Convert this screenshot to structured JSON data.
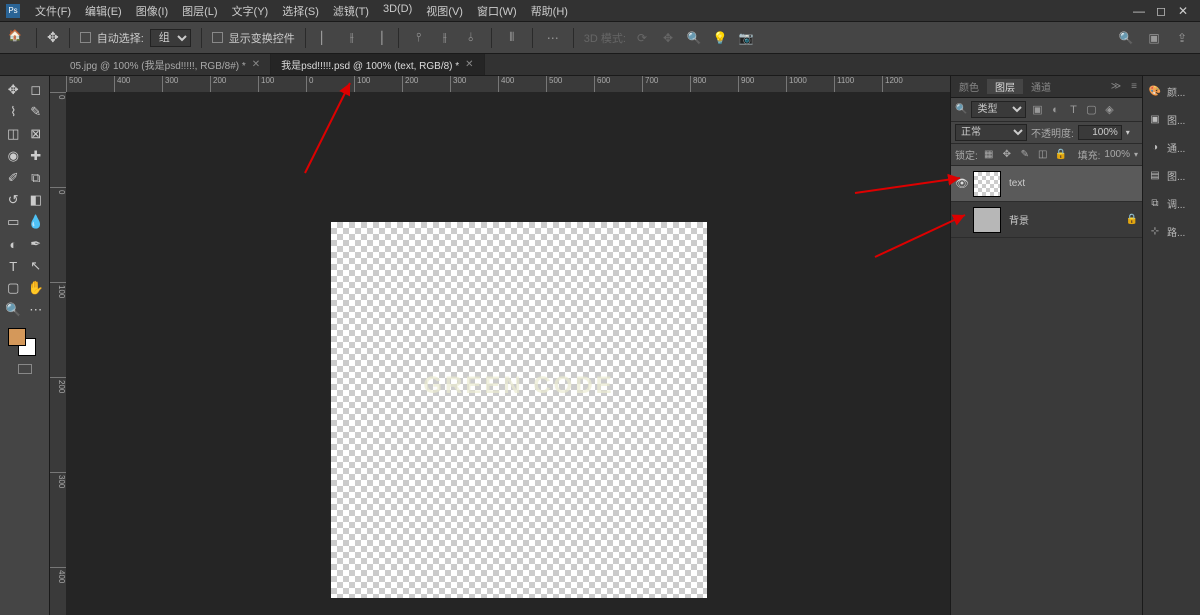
{
  "menubar": {
    "items": [
      "文件(F)",
      "编辑(E)",
      "图像(I)",
      "图层(L)",
      "文字(Y)",
      "选择(S)",
      "滤镜(T)",
      "3D(D)",
      "视图(V)",
      "窗口(W)",
      "帮助(H)"
    ]
  },
  "optionsbar": {
    "auto_select_label": "自动选择:",
    "auto_select_mode": "组",
    "show_transform_label": "显示变换控件",
    "mode3d_label": "3D 模式:"
  },
  "tabs": [
    {
      "label": "05.jpg @ 100% (我是psd!!!!!, RGB/8#) *",
      "active": false
    },
    {
      "label": "我是psd!!!!!.psd @ 100% (text, RGB/8) *",
      "active": true
    }
  ],
  "ruler_h": [
    "500",
    "400",
    "300",
    "200",
    "100",
    "0",
    "100",
    "200",
    "300",
    "400",
    "500",
    "600",
    "700",
    "800",
    "900",
    "1000",
    "1100",
    "1200"
  ],
  "ruler_v": [
    "0",
    "0",
    "100",
    "200",
    "300",
    "400"
  ],
  "canvas": {
    "watermark_small": "",
    "watermark_large": "GREEN CODE"
  },
  "panels": {
    "tabs": [
      "颜色",
      "图层",
      "通道"
    ],
    "active_tab": "图层",
    "filter_label": "类型",
    "blend_mode": "正常",
    "opacity_label": "不透明度:",
    "opacity_value": "100%",
    "lock_label": "锁定:",
    "fill_label": "填充:",
    "fill_value": "100%",
    "layers": [
      {
        "name": "text",
        "visible": true,
        "selected": true,
        "locked": false,
        "solid": false
      },
      {
        "name": "背景",
        "visible": false,
        "selected": false,
        "locked": true,
        "solid": true
      }
    ]
  },
  "strip": [
    {
      "icon": "🎨",
      "label": "颜..."
    },
    {
      "icon": "▣",
      "label": "图..."
    },
    {
      "icon": "◑",
      "label": "通..."
    },
    {
      "icon": "▤",
      "label": "图..."
    },
    {
      "icon": "⧉",
      "label": "调..."
    },
    {
      "icon": "⊹",
      "label": "路..."
    }
  ]
}
